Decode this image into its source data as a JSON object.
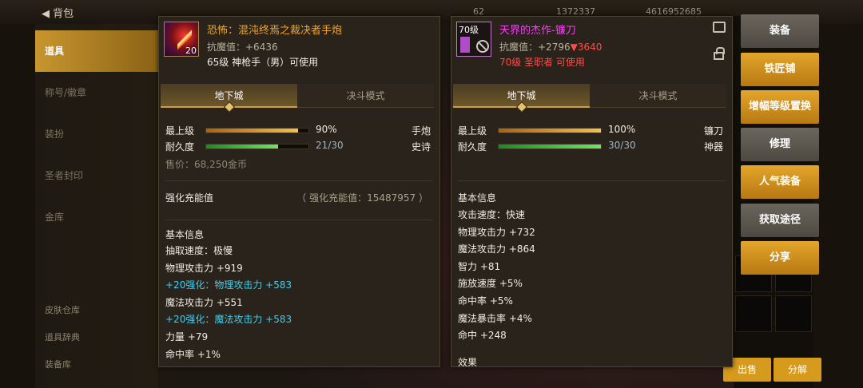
{
  "background": {
    "back_label": "背包",
    "top_stats": [
      "62",
      "1372337",
      "4616952685"
    ],
    "nav_items": [
      "道具",
      "称号/徽章",
      "装扮",
      "圣者封印",
      "金库"
    ],
    "nav_bottom": [
      "皮肤仓库",
      "道具辞典",
      "装备库"
    ],
    "bottom_buttons": [
      "出售",
      "分解"
    ]
  },
  "left_item": {
    "icon_level": "20",
    "title": "恐怖：混沌终焉之裁决者手炮",
    "anti_magic": "抗魔值：+6436",
    "requirement": "65级 神枪手（男）可使用",
    "tabs": [
      "地下城",
      "决斗模式"
    ],
    "level_label": "最上级",
    "level_value": "90%",
    "level_pct": 0.9,
    "durability_label": "耐久度",
    "durability_value": "21/30",
    "durability_pct": 0.7,
    "type": "手炮",
    "rarity": "史诗",
    "sell_price": "售价：68,250金币",
    "enhance_title": "强化充能值",
    "enhance_value": "（ 强化充能值：15487957 ）",
    "basic_title": "基本信息",
    "stats": [
      {
        "text": "抽取速度：极慢",
        "cls": ""
      },
      {
        "text": "物理攻击力 +919",
        "cls": ""
      },
      {
        "text": "+20强化：物理攻击力 +583",
        "cls": "cyan"
      },
      {
        "text": "魔法攻击力 +551",
        "cls": ""
      },
      {
        "text": "+20强化：魔法攻击力 +583",
        "cls": "cyan"
      },
      {
        "text": "力量 +79",
        "cls": ""
      },
      {
        "text": "命中率 +1%",
        "cls": ""
      }
    ]
  },
  "right_item": {
    "icon_level": "70级",
    "title": "天界的杰作-镰刀",
    "anti_magic": "抗魔值：+2796",
    "anti_magic_down": "▼3640",
    "requirement": "70级 圣职者 可使用",
    "tabs": [
      "地下城",
      "决斗模式"
    ],
    "level_label": "最上级",
    "level_value": "100%",
    "level_pct": 1.0,
    "durability_label": "耐久度",
    "durability_value": "30/30",
    "durability_pct": 1.0,
    "type": "镰刀",
    "rarity": "神器",
    "basic_title": "基本信息",
    "stats": [
      "攻击速度：快速",
      "物理攻击力 +732",
      "魔法攻击力 +864",
      "智力 +81",
      "施放速度 +5%",
      "命中率 +5%",
      "魔法暴击率 +4%",
      "命中 +248"
    ],
    "effect_title": "效果"
  },
  "actions": [
    {
      "label": "装备",
      "style": "gray"
    },
    {
      "label": "铁匠铺",
      "style": "gold"
    },
    {
      "label": "增幅等级置换",
      "style": "gold"
    },
    {
      "label": "修理",
      "style": "gray"
    },
    {
      "label": "人气装备",
      "style": "gold"
    },
    {
      "label": "获取途径",
      "style": "gray"
    },
    {
      "label": "分享",
      "style": "gold"
    }
  ]
}
